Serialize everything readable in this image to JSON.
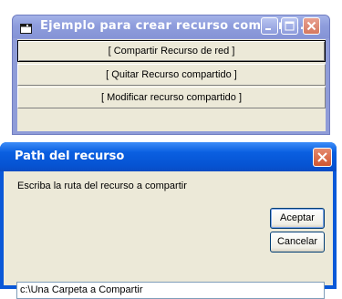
{
  "main_window": {
    "title": "Ejemplo para crear recurso compart...",
    "buttons": {
      "share": "[ Compartir Recurso de red ]",
      "unshare": "[ Quitar Recurso compartido ]",
      "modify": "[ Modificar recurso compartido ]"
    }
  },
  "dialog": {
    "title": "Path del recurso",
    "prompt": "Escriba la ruta del recurso a compartir",
    "ok_label": "Aceptar",
    "cancel_label": "Cancelar",
    "path_value": "c:\\Una Carpeta a Compartir"
  },
  "colors": {
    "inactive_title": "#8e9ddc",
    "active_title": "#0a58d8",
    "close_red": "#d2562f",
    "face": "#ece9d8"
  }
}
